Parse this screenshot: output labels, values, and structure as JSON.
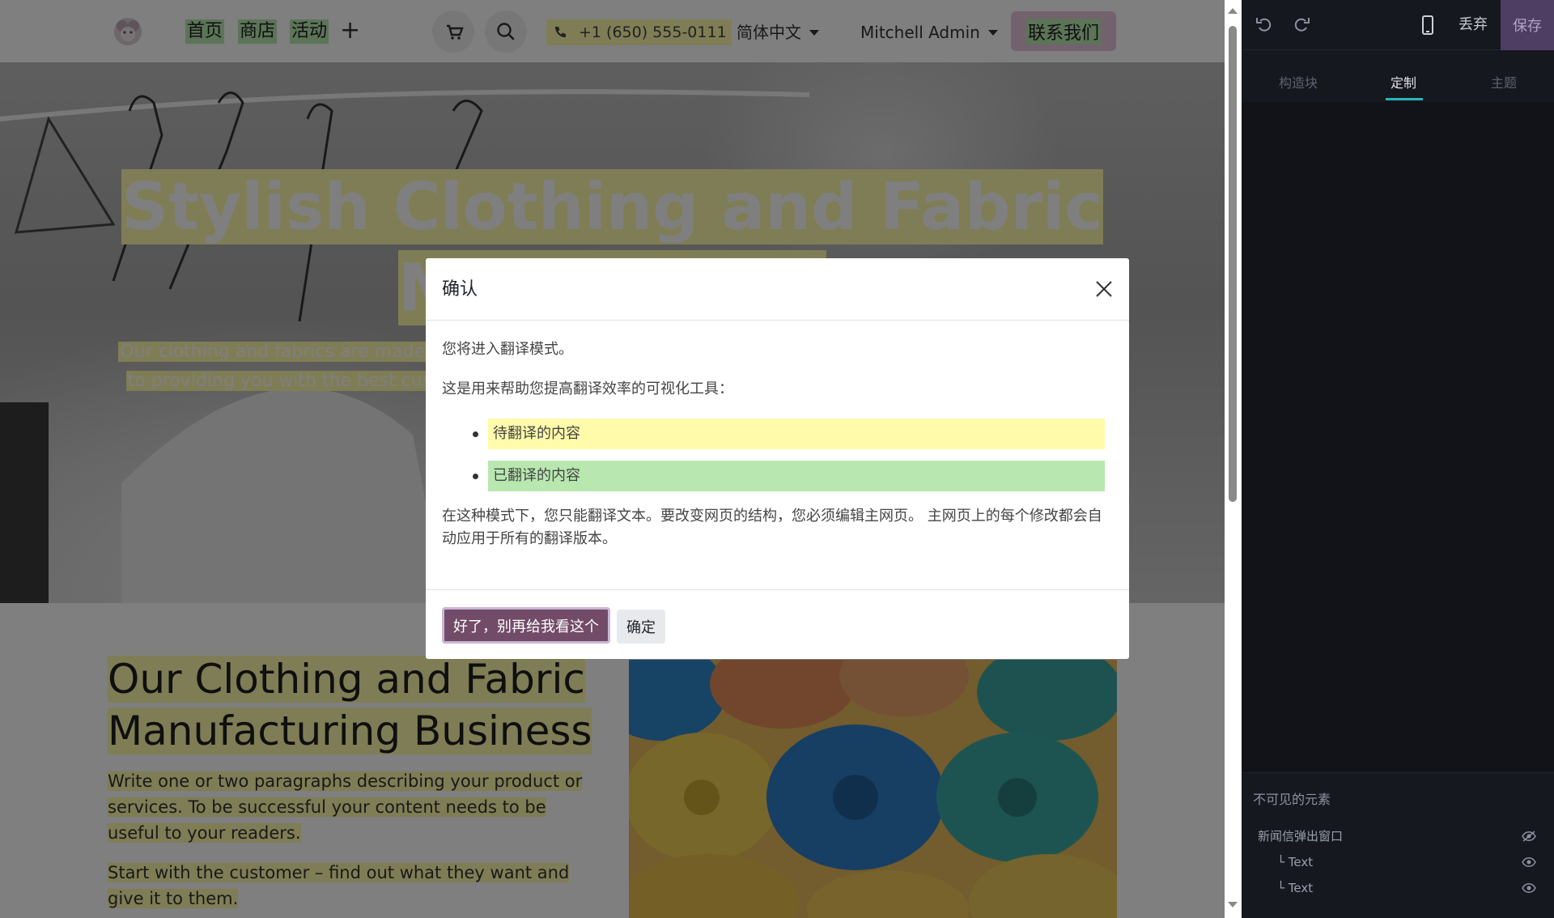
{
  "navbar": {
    "links": [
      "首页",
      "商店",
      "活动"
    ],
    "add_label": "+",
    "phone": "+1 (650) 555-0111",
    "language": "简体中文",
    "user": "Mitchell Admin",
    "contact_button": "联系我们"
  },
  "hero": {
    "title_line1": "Stylish Clothing and Fabric",
    "title_line2_visible": "M",
    "subtitle_line1": "Our clothing and fabrics are made wit",
    "subtitle_line2": "to providing you with the best custo"
  },
  "content": {
    "heading_line1": "Our Clothing and Fabric",
    "heading_line2": "Manufacturing Business",
    "paragraph1": "Write one or two paragraphs describing your product or services. To be successful your content needs to be useful to your readers.",
    "paragraph2": "Start with the customer – find out what they want and give it to them."
  },
  "modal": {
    "title": "确认",
    "intro": "您将进入翻译模式。",
    "tool_description": "这是用来帮助您提高翻译效率的可视化工具：",
    "legend_to_translate": "待翻译的内容",
    "legend_translated": "已翻译的内容",
    "explanation": "在这种模式下，您只能翻译文本。要改变网页的结构，您必须编辑主网页。 主网页上的每个修改都会自动应用于所有的翻译版本。",
    "primary_button": "好了，别再给我看这个",
    "secondary_button": "确定"
  },
  "editor_panel": {
    "discard": "丢弃",
    "save": "保存",
    "tabs": [
      "构造块",
      "定制",
      "主题"
    ],
    "active_tab": "定制",
    "invisible_title": "不可见的元素",
    "invisible_items": [
      "新闻信弹出窗口",
      "└ Text",
      "└ Text"
    ]
  },
  "colors": {
    "translate_pending": "#fffbaa",
    "translated": "#b8e8b0",
    "primary": "#714b67",
    "tab_accent": "#29b5b8"
  }
}
